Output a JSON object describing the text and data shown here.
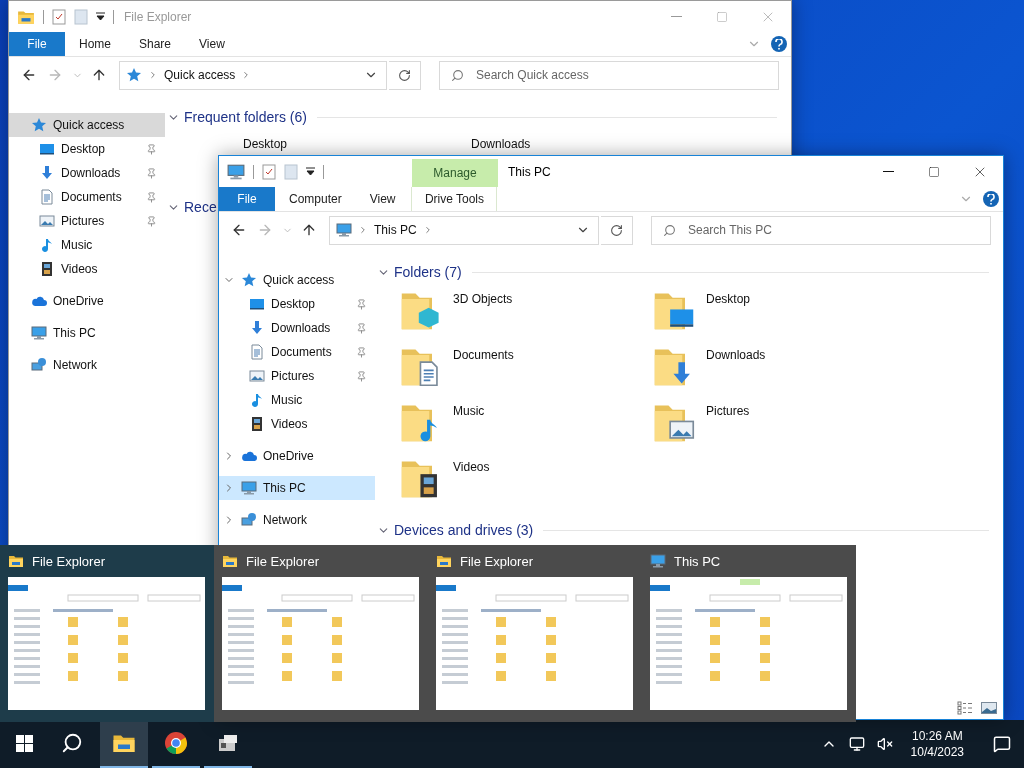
{
  "windows": [
    {
      "title": "File Explorer",
      "active": false,
      "ribbon": {
        "tabs": [
          {
            "label": "File",
            "kind": "file"
          },
          {
            "label": "Home",
            "kind": "tab"
          },
          {
            "label": "Share",
            "kind": "tab"
          },
          {
            "label": "View",
            "kind": "tab"
          }
        ]
      },
      "address": {
        "kind": "star",
        "label": "Quick access"
      },
      "search_placeholder": "Search Quick access",
      "nav": [
        {
          "label": "Quick access",
          "kind": "star",
          "selected": true,
          "children": [
            {
              "label": "Desktop",
              "kind": "desktop",
              "selected": false,
              "pinned": true
            },
            {
              "label": "Downloads",
              "kind": "downloads",
              "selected": false,
              "pinned": true
            },
            {
              "label": "Documents",
              "kind": "documents",
              "selected": false,
              "pinned": true
            },
            {
              "label": "Pictures",
              "kind": "pictures",
              "selected": false,
              "pinned": true
            },
            {
              "label": "Music",
              "kind": "music",
              "selected": false,
              "pinned": false
            },
            {
              "label": "Videos",
              "kind": "videos",
              "selected": false,
              "pinned": false
            }
          ]
        },
        {
          "label": "OneDrive",
          "kind": "cloud",
          "selected": false
        },
        {
          "label": "This PC",
          "kind": "pc",
          "selected": false
        },
        {
          "label": "Network",
          "kind": "network",
          "selected": false
        }
      ],
      "sections": [
        {
          "title": "Frequent folders (6)",
          "expanded": true,
          "items": [
            {
              "label": "Desktop"
            },
            {
              "label": "Downloads"
            }
          ]
        },
        {
          "title": "Rece",
          "expanded": true
        }
      ]
    },
    {
      "title": "This PC",
      "active": true,
      "ribbon": {
        "tabs": [
          {
            "label": "File",
            "kind": "file"
          },
          {
            "label": "Computer",
            "kind": "tab"
          },
          {
            "label": "View",
            "kind": "tab"
          }
        ],
        "context": {
          "header": "Manage",
          "tab": "Drive Tools"
        }
      },
      "address": {
        "kind": "pc",
        "label": "This PC"
      },
      "search_placeholder": "Search This PC",
      "nav": [
        {
          "label": "Quick access",
          "kind": "star",
          "selected": false,
          "expanded": true,
          "children": [
            {
              "label": "Desktop",
              "kind": "desktop",
              "selected": false,
              "pinned": true
            },
            {
              "label": "Downloads",
              "kind": "downloads",
              "selected": false,
              "pinned": true
            },
            {
              "label": "Documents",
              "kind": "documents",
              "selected": false,
              "pinned": true
            },
            {
              "label": "Pictures",
              "kind": "pictures",
              "selected": false,
              "pinned": true
            },
            {
              "label": "Music",
              "kind": "music",
              "selected": false,
              "pinned": false
            },
            {
              "label": "Videos",
              "kind": "videos",
              "selected": false,
              "pinned": false
            }
          ]
        },
        {
          "label": "OneDrive",
          "kind": "cloud",
          "selected": false,
          "expanded": false
        },
        {
          "label": "This PC",
          "kind": "pc",
          "selected": true,
          "expanded": false
        },
        {
          "label": "Network",
          "kind": "network",
          "selected": false,
          "expanded": false
        }
      ],
      "sections": [
        {
          "title": "Folders (7)",
          "expanded": true,
          "items": [
            {
              "label": "3D Objects",
              "kind": "cube"
            },
            {
              "label": "Desktop",
              "kind": "desktop"
            },
            {
              "label": "Documents",
              "kind": "documents"
            },
            {
              "label": "Downloads",
              "kind": "downloads"
            },
            {
              "label": "Music",
              "kind": "music"
            },
            {
              "label": "Pictures",
              "kind": "pictures"
            },
            {
              "label": "Videos",
              "kind": "videos"
            }
          ]
        },
        {
          "title": "Devices and drives (3)",
          "expanded": true
        }
      ]
    }
  ],
  "switcher": [
    {
      "title": "File Explorer",
      "kind": "explorer",
      "selected": true
    },
    {
      "title": "File Explorer",
      "kind": "explorer",
      "selected": false
    },
    {
      "title": "File Explorer",
      "kind": "explorer",
      "selected": false
    },
    {
      "title": "This PC",
      "kind": "pc",
      "selected": false
    }
  ],
  "taskbar": {
    "apps": [
      {
        "kind": "explorer",
        "selected": true,
        "running": true
      },
      {
        "kind": "browser",
        "selected": false,
        "running": true
      },
      {
        "kind": "app",
        "selected": false,
        "running": true
      }
    ],
    "clock": {
      "time": "10:26 AM",
      "date": "10/4/2023"
    }
  }
}
